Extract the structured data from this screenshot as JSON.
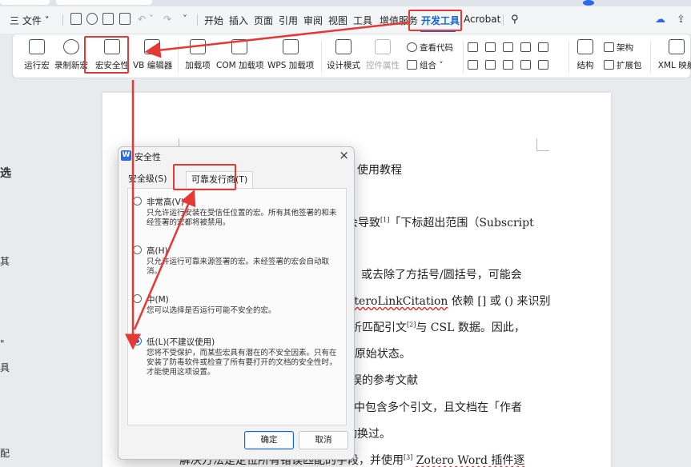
{
  "menubar": {
    "file": "三 文件 ˅",
    "tabs": [
      "开始",
      "插入",
      "页面",
      "引用",
      "审阅",
      "视图",
      "工具",
      "增值服务",
      "开发工具",
      "Acrobat"
    ],
    "active_tab": "开发工具"
  },
  "ribbon": {
    "buttons": [
      {
        "label": "运行宏"
      },
      {
        "label": "录制新宏"
      },
      {
        "label": "宏安全性"
      },
      {
        "label": "VB 编辑器"
      },
      {
        "label": "加载项"
      },
      {
        "label": "COM 加载项"
      },
      {
        "label": "WPS 加载项"
      },
      {
        "label": "设计模式"
      },
      {
        "label": "控件属性"
      }
    ],
    "view_code": "查看代码",
    "combine": "组合 ˅",
    "structure": "结构",
    "architecture": "架构",
    "extension": "扩展包",
    "xml_mapping": "XML 映射"
  },
  "document": {
    "lines": [
      {
        "text": "使用教程"
      },
      {
        "pre": "会导致",
        "sup": "[1]",
        "post": "「下标超出范围（Subscript"
      },
      {
        "text": "或去除了方括号/圆括号，可能会"
      },
      {
        "pre": "",
        "wavy": "oteroLinkCitation",
        "post": " 依赖 [] 或 () 来识别"
      },
      {
        "pre": "解析匹配引文",
        "sup": "[2]",
        "post": "与 CSL 数据。因此，"
      },
      {
        "text": "o 原始状态。"
      },
      {
        "text": "错误的参考文献"
      },
      {
        "text": "段中包含多个引文，且文档在「作者"
      },
      {
        "text": "动换过。"
      },
      {
        "pre": "解决方法是定位所有错误匹配的字段，并使用",
        "sup": "[3]",
        "post": " Zotero Word 插件逐"
      }
    ],
    "left_edge": [
      "选",
      "其",
      "\"",
      "具",
      "配"
    ]
  },
  "dialog": {
    "title": "安全性",
    "close": "×",
    "tab_level": "安全级(S)",
    "tab_trusted": "可靠发行商(T)",
    "options": [
      {
        "label": "非常高(V)",
        "desc": "只允许运行安装在受信任位置的宏。所有其他签署的和未经签署的宏都将被禁用。",
        "selected": false
      },
      {
        "label": "高(H)",
        "desc": "只允许运行可靠来源签署的宏。未经签署的宏会自动取消。",
        "selected": false
      },
      {
        "label": "中(M)",
        "desc": "您可以选择是否运行可能不安全的宏。",
        "selected": false
      },
      {
        "label": "低(L)(不建议使用)",
        "desc": "您将不受保护，而某些宏具有潜在的不安全因素。只有在安装了防毒软件或检查了所有要打开的文档的安全性时，才能使用这项设置。",
        "selected": true
      }
    ],
    "ok": "确定",
    "cancel": "取消"
  },
  "colors": {
    "accent": "#1765d1",
    "annotation": "#e53935"
  }
}
